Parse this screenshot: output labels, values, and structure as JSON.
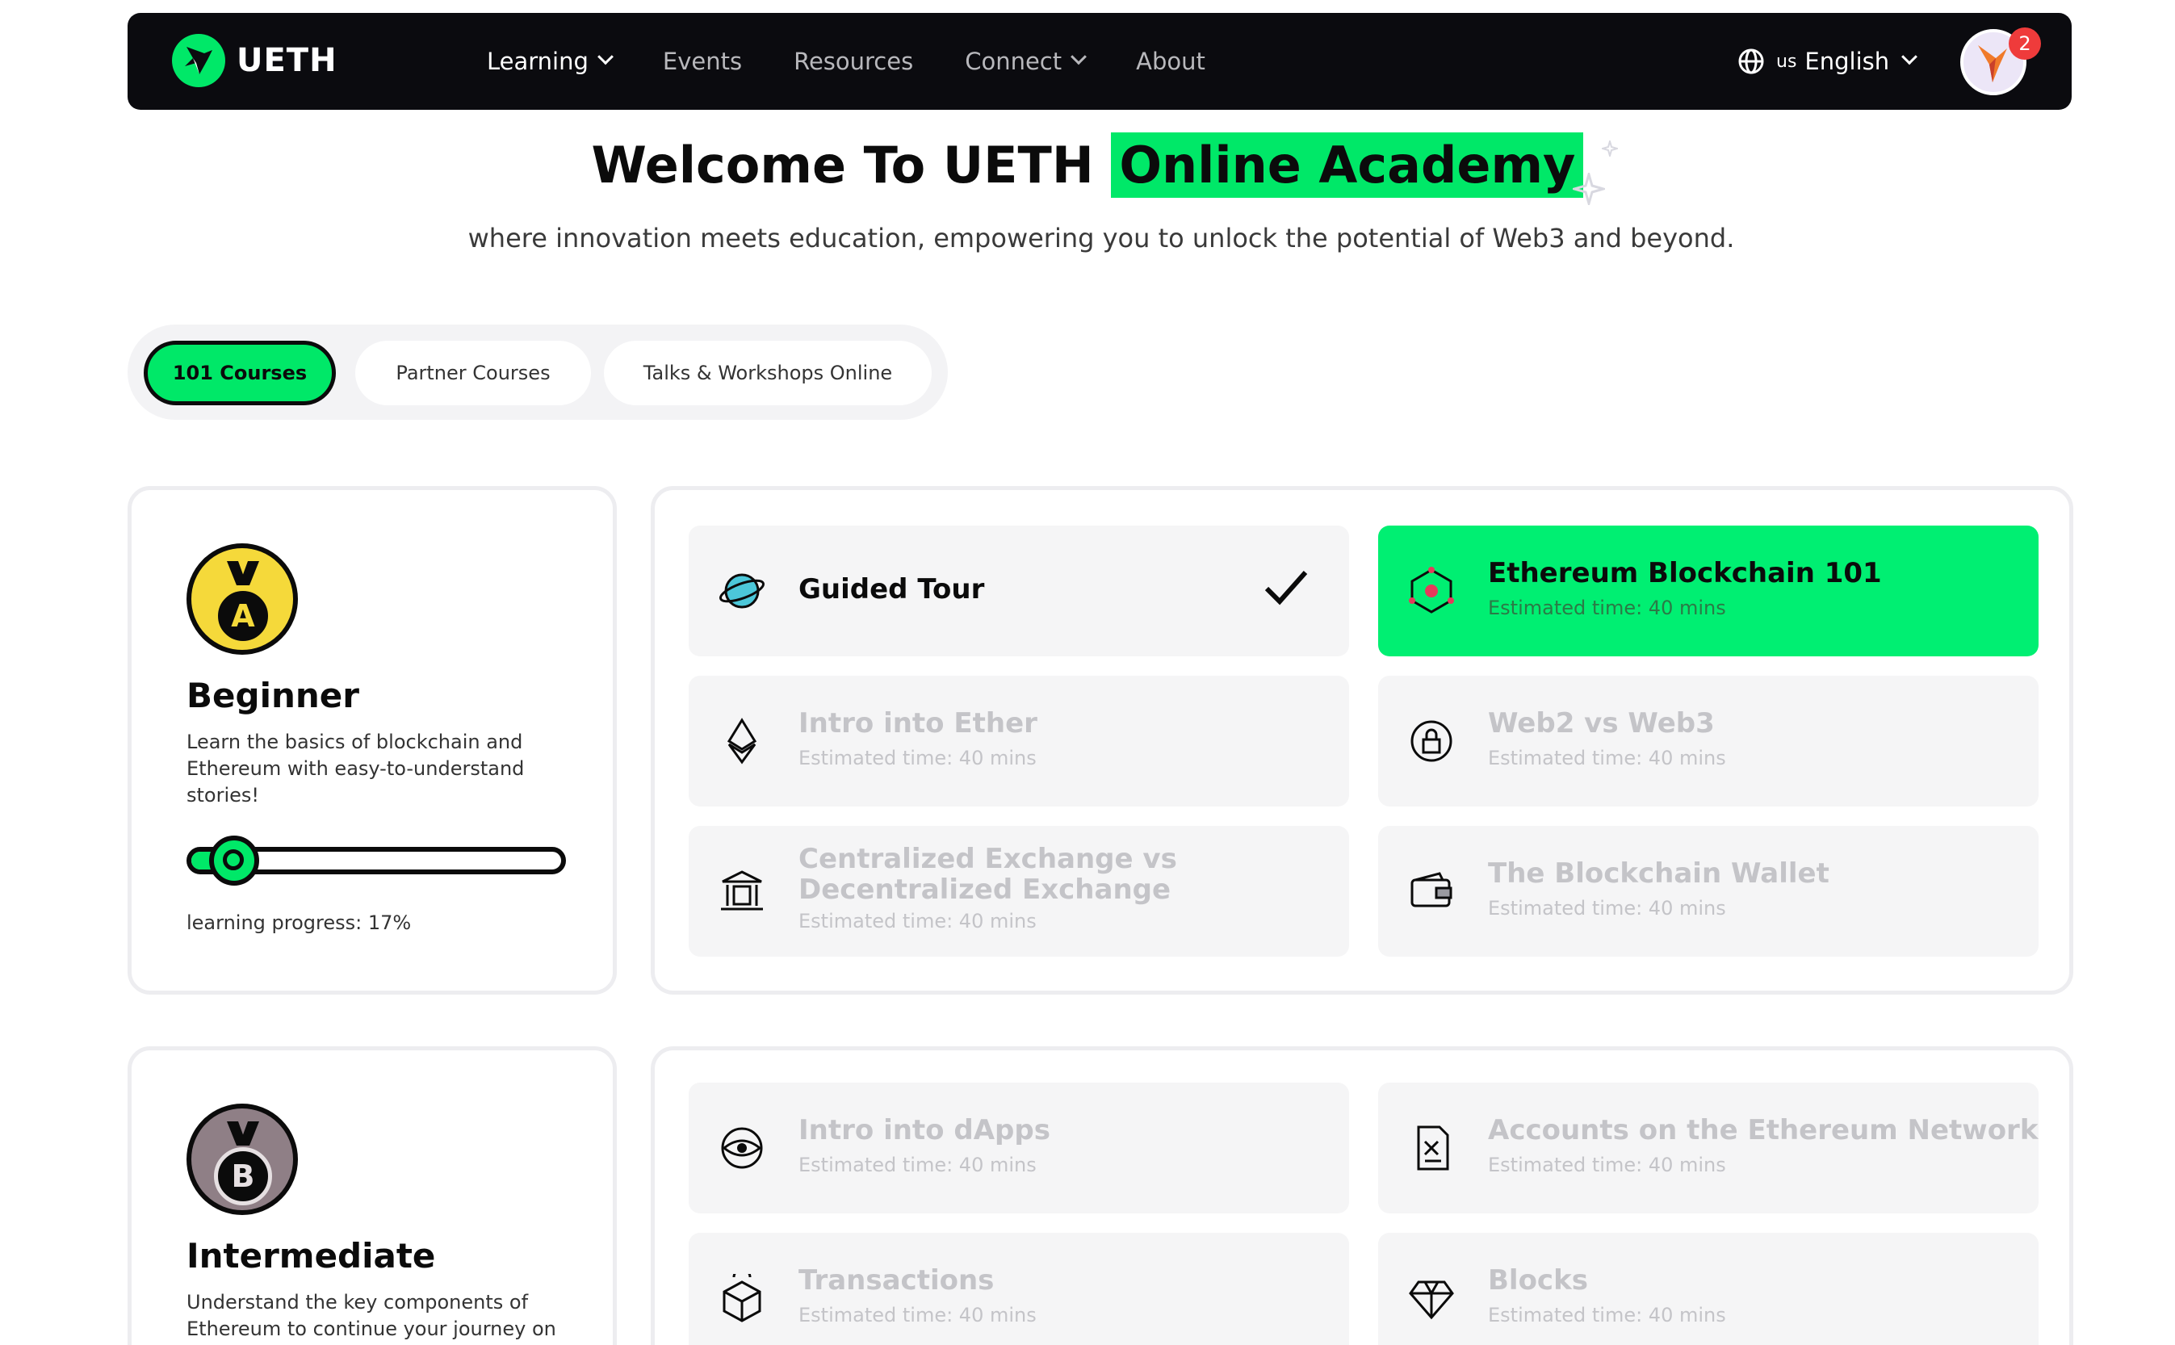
{
  "navbar": {
    "brand": "UETH",
    "links": [
      {
        "label": "Learning",
        "dropdown": true,
        "active": true
      },
      {
        "label": "Events",
        "dropdown": false,
        "active": false
      },
      {
        "label": "Resources",
        "dropdown": false,
        "active": false
      },
      {
        "label": "Connect",
        "dropdown": true,
        "active": false
      },
      {
        "label": "About",
        "dropdown": false,
        "active": false
      }
    ],
    "language_flag": "us",
    "language": "English",
    "notification_count": "2"
  },
  "hero": {
    "title_prefix": "Welcome To UETH",
    "title_highlight": "Online Academy",
    "subtitle": "where innovation meets education, empowering you to unlock the potential of Web3 and beyond."
  },
  "tabs": [
    {
      "label": "101 Courses",
      "active": true
    },
    {
      "label": "Partner Courses",
      "active": false
    },
    {
      "label": "Talks & Workshops Online",
      "active": false
    }
  ],
  "levels": [
    {
      "badge_letter": "A",
      "badge_color": "#f5d93a",
      "title": "Beginner",
      "description": "Learn the basics of blockchain and Ethereum with easy-to-understand stories!",
      "progress_percent": 17,
      "progress_label": "learning progress: 17%",
      "courses": [
        {
          "title": "Guided Tour",
          "time": "",
          "icon": "planet-icon",
          "state": "done"
        },
        {
          "title": "Ethereum Blockchain 101",
          "time": "Estimated time: 40 mins",
          "icon": "network-cube-icon",
          "state": "active"
        },
        {
          "title": "Intro into Ether",
          "time": "Estimated time: 40 mins",
          "icon": "ether-icon",
          "state": "locked"
        },
        {
          "title": "Web2 vs Web3",
          "time": "Estimated time: 40 mins",
          "icon": "lock-globe-icon",
          "state": "locked"
        },
        {
          "title": "Centralized Exchange vs Decentralized Exchange",
          "time": "Estimated time: 40 mins",
          "icon": "bank-icon",
          "state": "locked"
        },
        {
          "title": "The Blockchain Wallet",
          "time": "Estimated time: 40 mins",
          "icon": "wallet-icon",
          "state": "locked"
        }
      ]
    },
    {
      "badge_letter": "B",
      "badge_color": "#8f7f86",
      "title": "Intermediate",
      "description": "Understand the key components of Ethereum to continue your journey on Ethereum!",
      "courses": [
        {
          "title": "Intro into dApps",
          "time": "Estimated time: 40 mins",
          "icon": "eye-icon",
          "state": "locked"
        },
        {
          "title": "Accounts on the Ethereum Network",
          "time": "Estimated time: 40 mins",
          "icon": "document-icon",
          "state": "locked"
        },
        {
          "title": "Transactions",
          "time": "Estimated time: 40 mins",
          "icon": "box-transfer-icon",
          "state": "locked"
        },
        {
          "title": "Blocks",
          "time": "Estimated time: 40 mins",
          "icon": "diamond-icon",
          "state": "locked"
        }
      ]
    }
  ],
  "colors": {
    "accent": "#00e868",
    "nav_bg": "#0b0b0f",
    "card_bg": "#f5f5f6",
    "muted_text": "#c4c4c8"
  }
}
